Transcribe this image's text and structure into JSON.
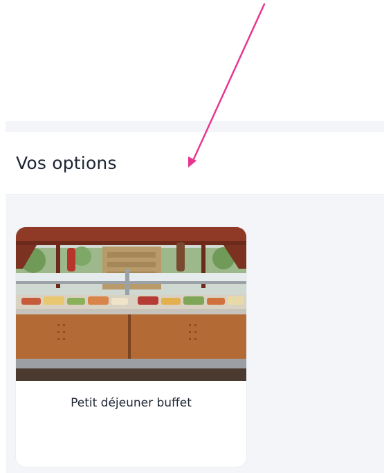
{
  "section": {
    "title": "Vos options"
  },
  "options": [
    {
      "label": "Petit déjeuner buffet",
      "image_icon": "buffet-photo"
    }
  ],
  "colors": {
    "annotation_arrow": "#e8368f",
    "page_background": "#f4f5f9",
    "title_text": "#1d2433"
  }
}
